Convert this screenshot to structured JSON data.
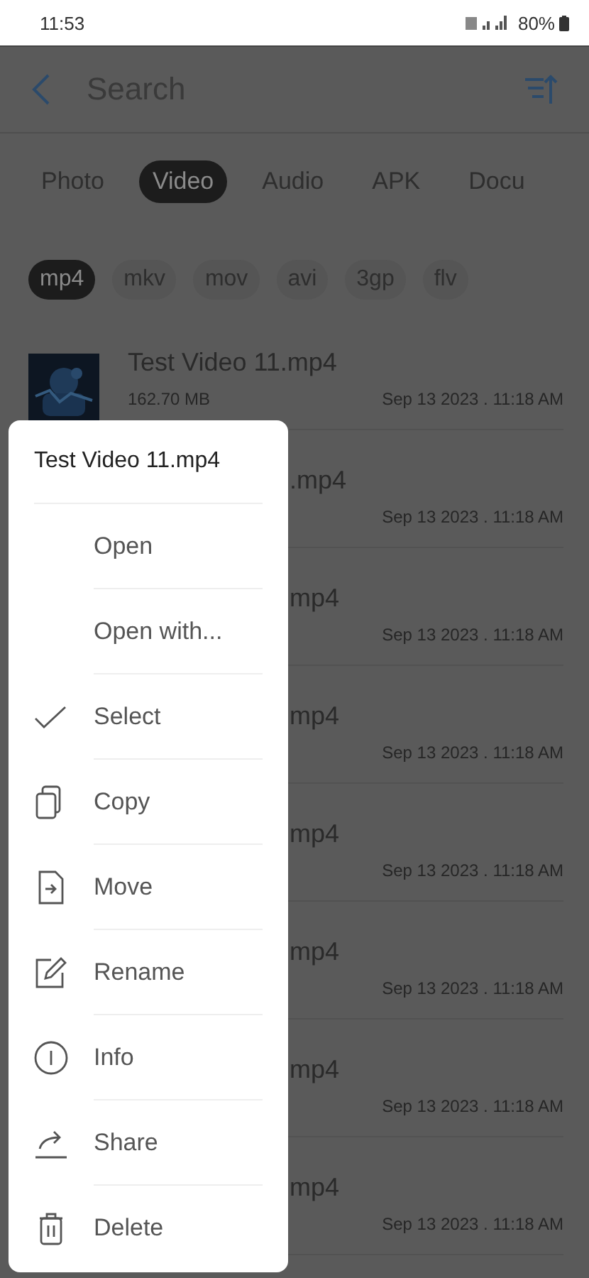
{
  "status_bar": {
    "time": "11:53",
    "battery": "80%"
  },
  "header": {
    "search_placeholder": "Search"
  },
  "categories": [
    {
      "label": "Photo",
      "selected": false
    },
    {
      "label": "Video",
      "selected": true
    },
    {
      "label": "Audio",
      "selected": false
    },
    {
      "label": "APK",
      "selected": false
    },
    {
      "label": "Docu",
      "selected": false
    }
  ],
  "formats": [
    {
      "label": "mp4",
      "selected": true
    },
    {
      "label": "mkv",
      "selected": false
    },
    {
      "label": "mov",
      "selected": false
    },
    {
      "label": "avi",
      "selected": false
    },
    {
      "label": "3gp",
      "selected": false
    },
    {
      "label": "flv",
      "selected": false
    }
  ],
  "files": [
    {
      "kind": "full",
      "name": "Test Video 11.mp4",
      "size": "162.70 MB",
      "date": "Sep 13 2023 . 11:18 AM"
    },
    {
      "kind": "covered",
      "name": ".mp4",
      "date": "Sep 13 2023 . 11:18 AM"
    },
    {
      "kind": "covered",
      "name": "mp4",
      "date": "Sep 13 2023 . 11:18 AM"
    },
    {
      "kind": "covered",
      "name": "mp4",
      "date": "Sep 13 2023 . 11:18 AM"
    },
    {
      "kind": "covered",
      "name": "mp4",
      "date": "Sep 13 2023 . 11:18 AM"
    },
    {
      "kind": "covered",
      "name": "mp4",
      "date": "Sep 13 2023 . 11:18 AM"
    },
    {
      "kind": "covered",
      "name": "mp4",
      "date": "Sep 13 2023 . 11:18 AM"
    },
    {
      "kind": "covered",
      "name": "mp4",
      "date": "Sep 13 2023 . 11:18 AM"
    }
  ],
  "context_menu": {
    "title": "Test Video 11.mp4",
    "items": [
      {
        "kind": "plain",
        "label": "Open"
      },
      {
        "kind": "plain",
        "label": "Open with..."
      },
      {
        "kind": "check",
        "label": "Select"
      },
      {
        "kind": "copy",
        "label": "Copy"
      },
      {
        "kind": "move",
        "label": "Move"
      },
      {
        "kind": "rename",
        "label": "Rename"
      },
      {
        "kind": "info",
        "label": "Info"
      },
      {
        "kind": "share",
        "label": "Share"
      },
      {
        "kind": "delete",
        "label": "Delete"
      }
    ]
  }
}
